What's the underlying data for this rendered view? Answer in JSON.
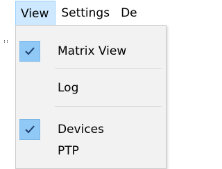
{
  "menubar": {
    "items": [
      {
        "label": "View"
      },
      {
        "label": "Settings"
      },
      {
        "label": "De"
      }
    ]
  },
  "view_menu": {
    "items": [
      {
        "label": "Matrix View",
        "checked": true
      },
      {
        "label": "Log",
        "checked": false
      },
      {
        "label": "Devices",
        "checked": true
      },
      {
        "label": "PTP",
        "checked": false
      }
    ]
  },
  "colors": {
    "accent_highlight": "#cde8ff",
    "check_background": "#90c8f6",
    "menu_background": "#f2f2f2"
  }
}
